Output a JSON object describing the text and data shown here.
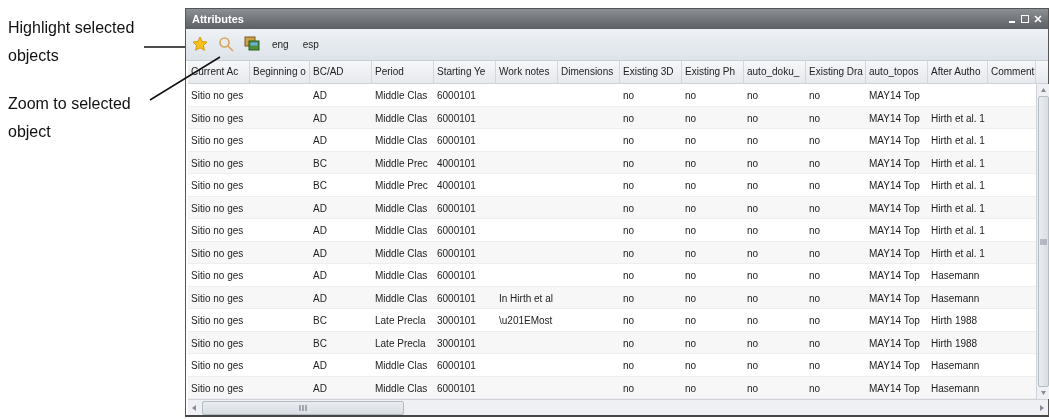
{
  "annotations": [
    {
      "text": "Highlight selected objects"
    },
    {
      "text": "Zoom to selected object"
    }
  ],
  "window": {
    "title": "Attributes"
  },
  "toolbar": [
    {
      "kind": "star"
    },
    {
      "kind": "zoom"
    },
    {
      "kind": "pictures"
    },
    {
      "kind": "text",
      "label": "eng"
    },
    {
      "kind": "text",
      "label": "esp"
    }
  ],
  "table": {
    "columns": [
      "Current Ac",
      "Beginning o",
      "BC/AD",
      "Period",
      "Starting Ye",
      "Work notes",
      "Dimensions",
      "Existing 3D",
      "Existing Ph",
      "auto_doku_",
      "Existing Dra",
      "auto_topos",
      "After Autho",
      "Comment"
    ],
    "rows": [
      [
        "Sitio no ges",
        null,
        "AD",
        "Middle Clas",
        "6000101",
        null,
        null,
        "no",
        "no",
        "no",
        "no",
        "MAY14 Top",
        null,
        null
      ],
      [
        "Sitio no ges",
        null,
        "AD",
        "Middle Clas",
        "6000101",
        null,
        null,
        "no",
        "no",
        "no",
        "no",
        "MAY14 Top",
        "Hirth et al. 1",
        null
      ],
      [
        "Sitio no ges",
        null,
        "AD",
        "Middle Clas",
        "6000101",
        null,
        null,
        "no",
        "no",
        "no",
        "no",
        "MAY14 Top",
        "Hirth et al. 1",
        null
      ],
      [
        "Sitio no ges",
        null,
        "BC",
        "Middle Prec",
        "4000101",
        null,
        null,
        "no",
        "no",
        "no",
        "no",
        "MAY14 Top",
        "Hirth et al. 1",
        null
      ],
      [
        "Sitio no ges",
        null,
        "BC",
        "Middle Prec",
        "4000101",
        null,
        null,
        "no",
        "no",
        "no",
        "no",
        "MAY14 Top",
        "Hirth et al. 1",
        null
      ],
      [
        "Sitio no ges",
        null,
        "AD",
        "Middle Clas",
        "6000101",
        null,
        null,
        "no",
        "no",
        "no",
        "no",
        "MAY14 Top",
        "Hirth et al. 1",
        null
      ],
      [
        "Sitio no ges",
        null,
        "AD",
        "Middle Clas",
        "6000101",
        null,
        null,
        "no",
        "no",
        "no",
        "no",
        "MAY14 Top",
        "Hirth et al. 1",
        null
      ],
      [
        "Sitio no ges",
        null,
        "AD",
        "Middle Clas",
        "6000101",
        null,
        null,
        "no",
        "no",
        "no",
        "no",
        "MAY14 Top",
        "Hirth et al. 1",
        null
      ],
      [
        "Sitio no ges",
        null,
        "AD",
        "Middle Clas",
        "6000101",
        null,
        null,
        "no",
        "no",
        "no",
        "no",
        "MAY14 Top",
        "Hasemann",
        null
      ],
      [
        "Sitio no ges",
        null,
        "AD",
        "Middle Clas",
        "6000101",
        "In Hirth et al",
        null,
        "no",
        "no",
        "no",
        "no",
        "MAY14 Top",
        "Hasemann",
        null
      ],
      [
        "Sitio no ges",
        null,
        "BC",
        "Late Precla",
        "3000101",
        "\\u201EMost",
        null,
        "no",
        "no",
        "no",
        "no",
        "MAY14 Top",
        "Hirth 1988",
        null
      ],
      [
        "Sitio no ges",
        null,
        "BC",
        "Late Precla",
        "3000101",
        null,
        null,
        "no",
        "no",
        "no",
        "no",
        "MAY14 Top",
        "Hirth 1988",
        null
      ],
      [
        "Sitio no ges",
        null,
        "AD",
        "Middle Clas",
        "6000101",
        null,
        null,
        "no",
        "no",
        "no",
        "no",
        "MAY14 Top",
        "Hasemann",
        null
      ],
      [
        "Sitio no ges",
        null,
        "AD",
        "Middle Clas",
        "6000101",
        null,
        null,
        "no",
        "no",
        "no",
        "no",
        "MAY14 Top",
        "Hasemann",
        null
      ]
    ]
  }
}
